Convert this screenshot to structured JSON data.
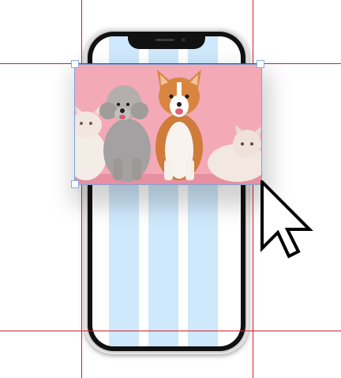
{
  "canvas": {
    "background": "#ffffff"
  },
  "phone": {
    "frame_color": "#cfcfcf",
    "screen_color": "#ffffff",
    "column_color": "#cfe8fb",
    "column_count": 3
  },
  "guides": {
    "color": "#d0202a",
    "count": 4
  },
  "selected_image": {
    "subject": "dog-and-cats-photo",
    "background_color": "#f3a9b6",
    "selected": true,
    "handle_color": "#8aaee0"
  },
  "cursor": {
    "icon": "arrow-cursor-icon"
  }
}
